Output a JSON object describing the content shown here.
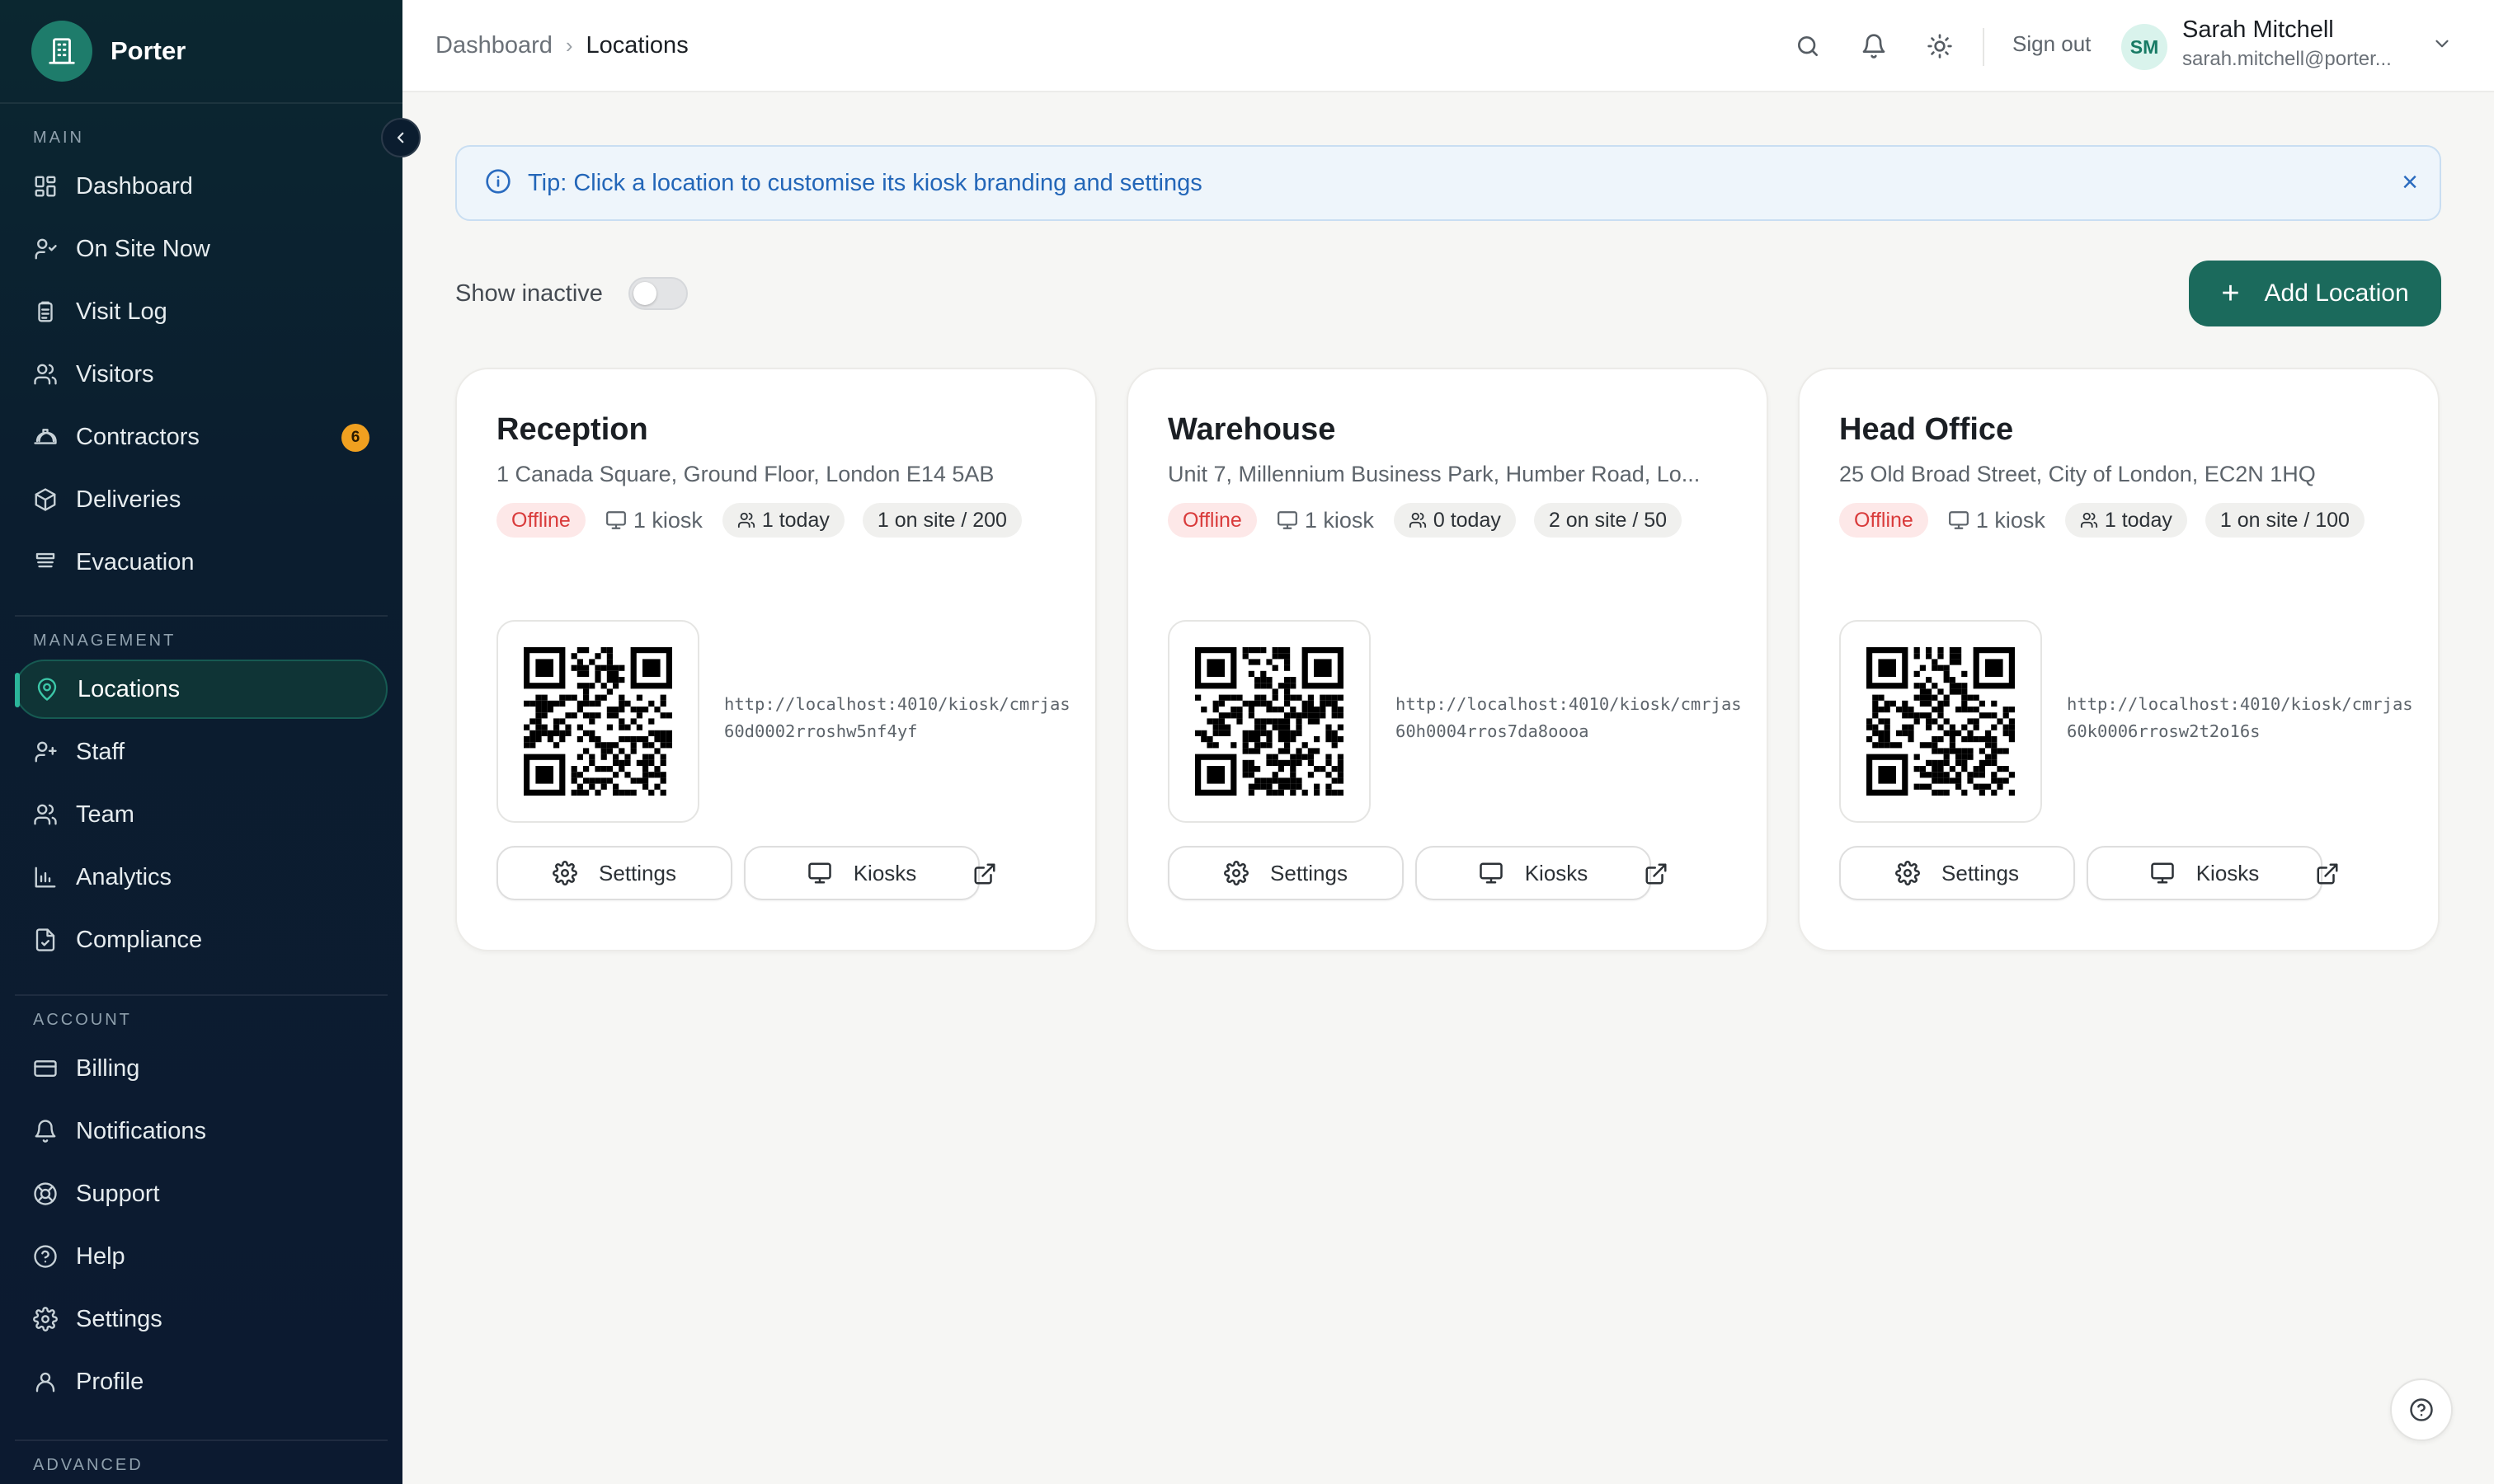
{
  "brand": {
    "name": "Porter"
  },
  "sidebar": {
    "sections": [
      {
        "label": "MAIN",
        "items": [
          {
            "label": "Dashboard",
            "icon": "dashboard-icon"
          },
          {
            "label": "On Site Now",
            "icon": "user-check-icon"
          },
          {
            "label": "Visit Log",
            "icon": "clipboard-icon"
          },
          {
            "label": "Visitors",
            "icon": "users-icon"
          },
          {
            "label": "Contractors",
            "icon": "hard-hat-icon",
            "badge": "6"
          },
          {
            "label": "Deliveries",
            "icon": "package-icon"
          },
          {
            "label": "Evacuation",
            "icon": "alarm-icon"
          }
        ]
      },
      {
        "label": "MANAGEMENT",
        "items": [
          {
            "label": "Locations",
            "icon": "map-pin-icon",
            "active": true
          },
          {
            "label": "Staff",
            "icon": "user-plus-icon"
          },
          {
            "label": "Team",
            "icon": "users-icon"
          },
          {
            "label": "Analytics",
            "icon": "bar-chart-icon"
          },
          {
            "label": "Compliance",
            "icon": "file-check-icon"
          }
        ]
      },
      {
        "label": "ACCOUNT",
        "items": [
          {
            "label": "Billing",
            "icon": "credit-card-icon"
          },
          {
            "label": "Notifications",
            "icon": "bell-icon"
          },
          {
            "label": "Support",
            "icon": "life-buoy-icon"
          },
          {
            "label": "Help",
            "icon": "help-circle-icon"
          },
          {
            "label": "Settings",
            "icon": "gear-icon"
          },
          {
            "label": "Profile",
            "icon": "user-icon"
          }
        ]
      },
      {
        "label": "ADVANCED",
        "items": []
      }
    ]
  },
  "header": {
    "breadcrumb": [
      "Dashboard",
      "Locations"
    ],
    "sign_out": "Sign out",
    "user": {
      "initials": "SM",
      "name": "Sarah Mitchell",
      "email": "sarah.mitchell@porter..."
    }
  },
  "tip": {
    "text": "Tip: Click a location to customise its kiosk branding and settings"
  },
  "toolbar": {
    "show_inactive_label": "Show inactive",
    "show_inactive_on": false,
    "add_label": "Add Location"
  },
  "locations": [
    {
      "name": "Reception",
      "address": "1 Canada Square, Ground Floor, London E14 5AB",
      "status": "Offline",
      "kiosks": "1 kiosk",
      "today": "1 today",
      "on_site": "1 on site / 200",
      "url": "http://localhost:4010/kiosk/cmrjas60d0002rroshw5nf4yf",
      "settings_label": "Settings",
      "kiosks_label": "Kiosks"
    },
    {
      "name": "Warehouse",
      "address": "Unit 7, Millennium Business Park, Humber Road, Lo...",
      "status": "Offline",
      "kiosks": "1 kiosk",
      "today": "0 today",
      "on_site": "2 on site / 50",
      "url": "http://localhost:4010/kiosk/cmrjas60h0004rros7da8oooa",
      "settings_label": "Settings",
      "kiosks_label": "Kiosks"
    },
    {
      "name": "Head Office",
      "address": "25 Old Broad Street, City of London, EC2N 1HQ",
      "status": "Offline",
      "kiosks": "1 kiosk",
      "today": "1 today",
      "on_site": "1 on site / 100",
      "url": "http://localhost:4010/kiosk/cmrjas60k0006rrosw2t2o16s",
      "settings_label": "Settings",
      "kiosks_label": "Kiosks"
    }
  ],
  "colors": {
    "brand": "#1b6a5c",
    "sidebar_bg": "#0c1a30",
    "offline": "#d93b3b",
    "tip": "#2366b8",
    "badge": "#f0a020"
  }
}
